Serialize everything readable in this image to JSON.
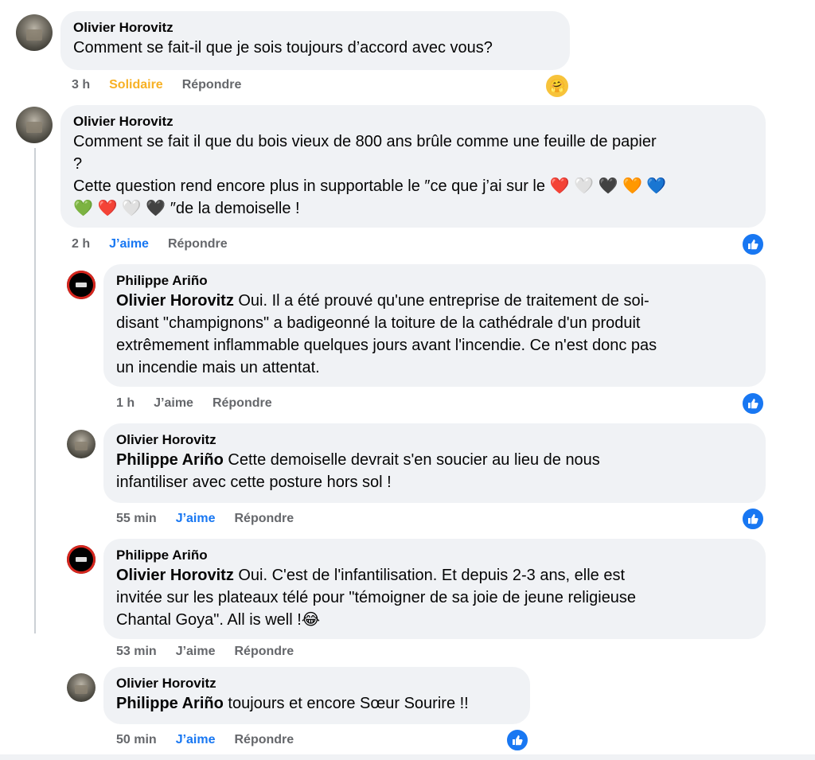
{
  "comments": [
    {
      "author": "Olivier Horovitz",
      "text": "Comment se fait-il que je sois toujours d’accord avec vous?",
      "time": "3 h",
      "reaction_label": "Solidaire",
      "reply_label": "Répondre",
      "reaction_icon": "care-reaction-icon"
    },
    {
      "author": "Olivier Horovitz",
      "line1": "Comment se fait il que du bois vieux de 800 ans brûle comme une feuille de papier",
      "line2": "?",
      "line3_prefix": "Cette question rend encore plus in supportable le ″ce que j’ai sur le",
      "line3_hearts": "❤️ 🤍 🖤 🧡 💙",
      "line4_hearts": "💚 ❤️ 🤍 🖤",
      "line4_suffix": "″de la demoiselle !",
      "time": "2 h",
      "like_label": "J’aime",
      "reply_label": "Répondre"
    },
    {
      "author": "Philippe Ariño",
      "mention": "Olivier Horovitz",
      "line1_after_mention": " Oui. Il a été prouvé qu'une entreprise de traitement de soi-",
      "line2": "disant \"champignons\" a badigeonné la toiture de la cathédrale d'un produit",
      "line3": "extrêmement inflammable quelques jours avant l'incendie. Ce n'est donc pas",
      "line4": "un incendie mais un attentat.",
      "time": "1 h",
      "like_label": "J’aime",
      "reply_label": "Répondre"
    },
    {
      "author": "Olivier Horovitz",
      "mention": "Philippe Ariño",
      "line1_after_mention": " Cette demoiselle devrait s'en soucier au lieu de nous",
      "line2": "infantiliser avec cette posture hors sol !",
      "time": "55 min",
      "like_label": "J’aime",
      "reply_label": "Répondre"
    },
    {
      "author": "Philippe Ariño",
      "mention": "Olivier Horovitz",
      "line1_after_mention": " Oui. C'est de l'infantilisation. Et depuis 2-3 ans, elle est",
      "line2": "invitée sur les plateaux télé pour \"témoigner de sa joie de jeune religieuse",
      "line3": "Chantal Goya\". All is well !😂",
      "time": "53 min",
      "like_label": "J’aime",
      "reply_label": "Répondre"
    },
    {
      "author": "Olivier Horovitz",
      "mention": "Philippe Ariño",
      "line1_after_mention": " toujours et encore Sœur Sourire !!",
      "time": "50 min",
      "like_label": "J’aime",
      "reply_label": "Répondre"
    }
  ],
  "colors": {
    "bubble": "#f0f2f5",
    "link_blue": "#1877f2",
    "muted": "#65676b",
    "solidaire": "#f7b125"
  }
}
